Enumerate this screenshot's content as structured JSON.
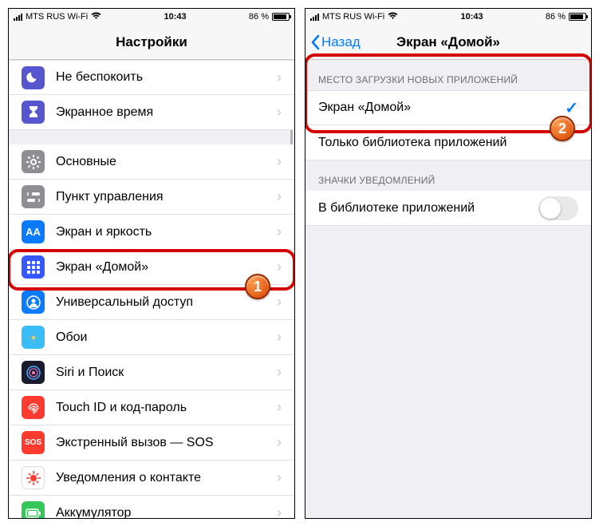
{
  "status": {
    "carrier": "MTS RUS Wi-Fi",
    "time": "10:43",
    "battery_pct": "86 %"
  },
  "left": {
    "title": "Настройки",
    "rows_a": [
      {
        "label": "Не беспокоить",
        "icon": "moon",
        "bg": "#5756ce"
      },
      {
        "label": "Экранное время",
        "icon": "hourglass",
        "bg": "#5756ce"
      }
    ],
    "rows_b": [
      {
        "label": "Основные",
        "icon": "gear",
        "bg": "#8e8e93"
      },
      {
        "label": "Пункт управления",
        "icon": "switches",
        "bg": "#8e8e93"
      },
      {
        "label": "Экран и яркость",
        "icon": "AA",
        "bg": "#0a7aff"
      },
      {
        "label": "Экран «Домой»",
        "icon": "grid",
        "bg": "#3558ff"
      },
      {
        "label": "Универсальный доступ",
        "icon": "person",
        "bg": "#0a7aff"
      },
      {
        "label": "Обои",
        "icon": "flower",
        "bg": "#38bdf8"
      },
      {
        "label": "Siri и Поиск",
        "icon": "siri",
        "bg": "#1b1b2e"
      },
      {
        "label": "Touch ID и код-пароль",
        "icon": "finger",
        "bg": "#ff3b30"
      },
      {
        "label": "Экстренный вызов — SOS",
        "icon": "SOS",
        "bg": "#ff3b30"
      },
      {
        "label": "Уведомления о контакте",
        "icon": "virus",
        "bg": "#ffffff"
      },
      {
        "label": "Аккумулятор",
        "icon": "battery",
        "bg": "#34c759"
      }
    ],
    "badge": "1"
  },
  "right": {
    "back": "Назад",
    "title": "Экран «Домой»",
    "section1_header": "МЕСТО ЗАГРУЗКИ НОВЫХ ПРИЛОЖЕНИЙ",
    "opt1": "Экран «Домой»",
    "opt2": "Только библиотека приложений",
    "section2_header": "ЗНАЧКИ УВЕДОМЛЕНИЙ",
    "opt3": "В библиотеке приложений",
    "badge": "2"
  }
}
